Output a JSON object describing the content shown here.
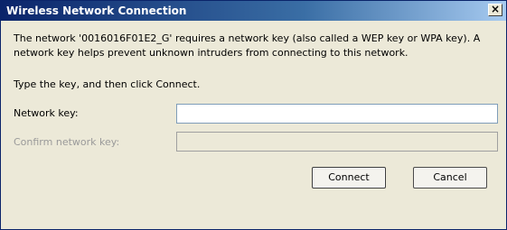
{
  "window": {
    "title": "Wireless Network Connection",
    "close_glyph": "×",
    "close_icon": "close-icon"
  },
  "dialog": {
    "description": "The network '0016016F01E2_G' requires a network key (also called a WEP key or WPA key). A network key helps prevent unknown intruders from connecting to this network.",
    "instruction": "Type the key, and then click Connect.",
    "network_key_label": "Network key:",
    "network_key_value": "",
    "confirm_key_label": "Confirm network key:",
    "confirm_key_value": "",
    "confirm_enabled": false
  },
  "buttons": {
    "connect_label": "Connect",
    "cancel_label": "Cancel"
  },
  "colors": {
    "title_bar_start": "#0a246a",
    "title_bar_end": "#a6caf0",
    "dialog_background": "#ece9d8",
    "disabled_text": "#9a9a9a"
  }
}
